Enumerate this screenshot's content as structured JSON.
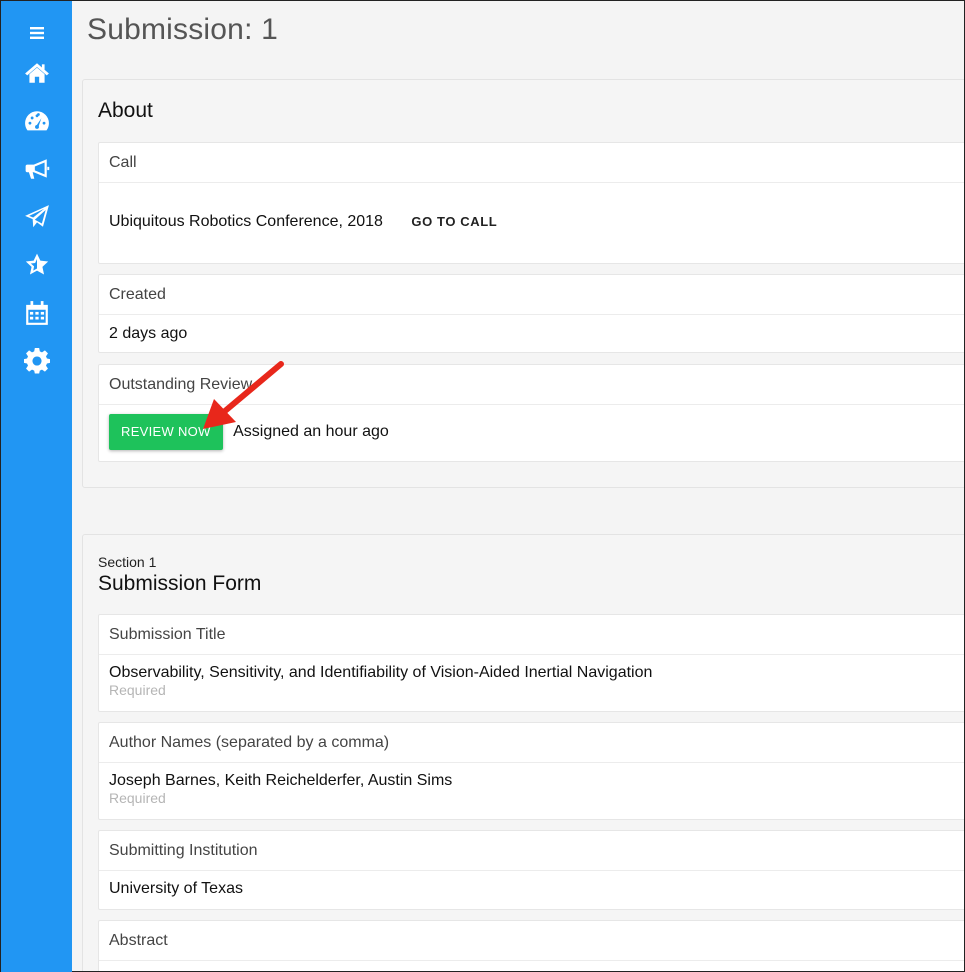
{
  "sidebar": {
    "icons": [
      "menu-icon",
      "home-icon",
      "dashboard-icon",
      "megaphone-icon",
      "send-icon",
      "star-icon",
      "calendar-icon",
      "settings-icon"
    ]
  },
  "page": {
    "title": "Submission: 1"
  },
  "about": {
    "heading": "About",
    "call": {
      "label": "Call",
      "value": "Ubiquitous Robotics Conference, 2018",
      "link": "GO TO CALL"
    },
    "created": {
      "label": "Created",
      "value": "2 days ago"
    },
    "outstanding": {
      "label": "Outstanding Review",
      "button": "REVIEW NOW",
      "assigned": "Assigned an hour ago"
    }
  },
  "form": {
    "section_label": "Section 1",
    "heading": "Submission Form",
    "fields": [
      {
        "label": "Submission Title",
        "value": "Observability, Sensitivity, and Identifiability of Vision-Aided Inertial Navigation",
        "note": "Required"
      },
      {
        "label": "Author Names (separated by a comma)",
        "value": "Joseph Barnes, Keith Reichelderfer, Austin Sims",
        "note": "Required"
      },
      {
        "label": "Submitting Institution",
        "value": "University of Texas"
      },
      {
        "label": "Abstract"
      }
    ]
  },
  "colors": {
    "sidebar": "#2196f3",
    "review_button": "#1ec25b",
    "annotation_arrow": "#e8271b"
  }
}
